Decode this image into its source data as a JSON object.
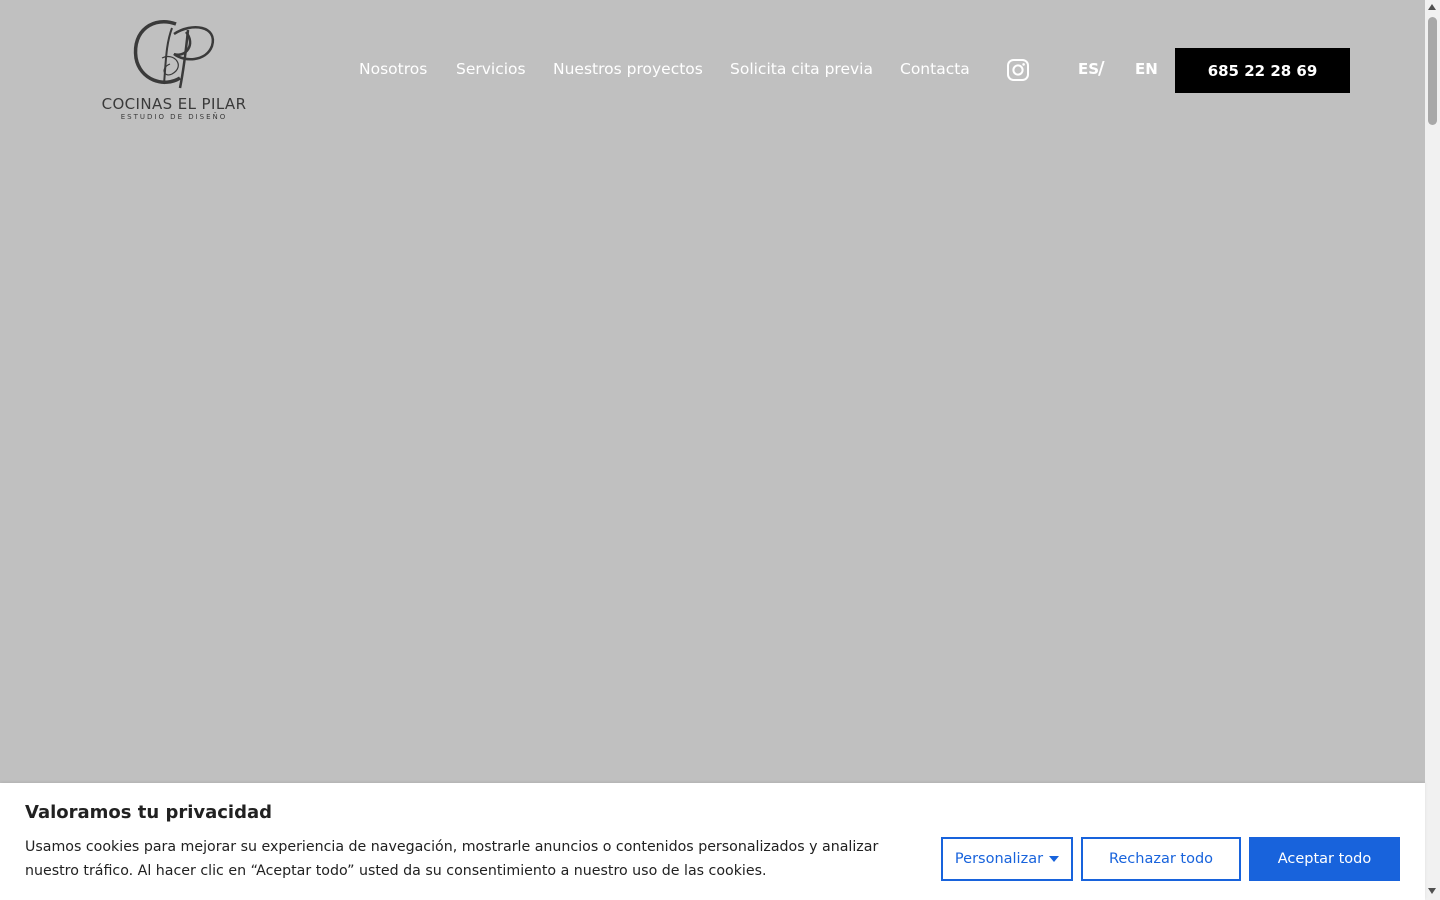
{
  "header": {
    "logo": {
      "monogram": "CP",
      "name": "COCINAS EL PILAR",
      "tagline": "ESTUDIO DE DISEÑO"
    },
    "nav": [
      {
        "label": "Nosotros"
      },
      {
        "label": "Servicios"
      },
      {
        "label": "Nuestros proyectos"
      },
      {
        "label": "Solicita cita previa"
      },
      {
        "label": "Contacta"
      }
    ],
    "social_icon": "instagram-icon",
    "languages": {
      "es": "ES",
      "separator": "/",
      "en": "EN"
    },
    "phone": "685 22 28 69"
  },
  "cookie_banner": {
    "title": "Valoramos tu privacidad",
    "text": "Usamos cookies para mejorar su experiencia de navegación, mostrarle anuncios o contenidos personalizados y analizar nuestro tráfico. Al hacer clic en “Aceptar todo” usted da su consentimiento a nuestro uso de las cookies.",
    "customize_label": "Personalizar",
    "reject_label": "Rechazar todo",
    "accept_label": "Aceptar todo"
  },
  "colors": {
    "page_background": "#c0c0c0",
    "accent": "#1863dc",
    "phone_button": "#000000"
  }
}
